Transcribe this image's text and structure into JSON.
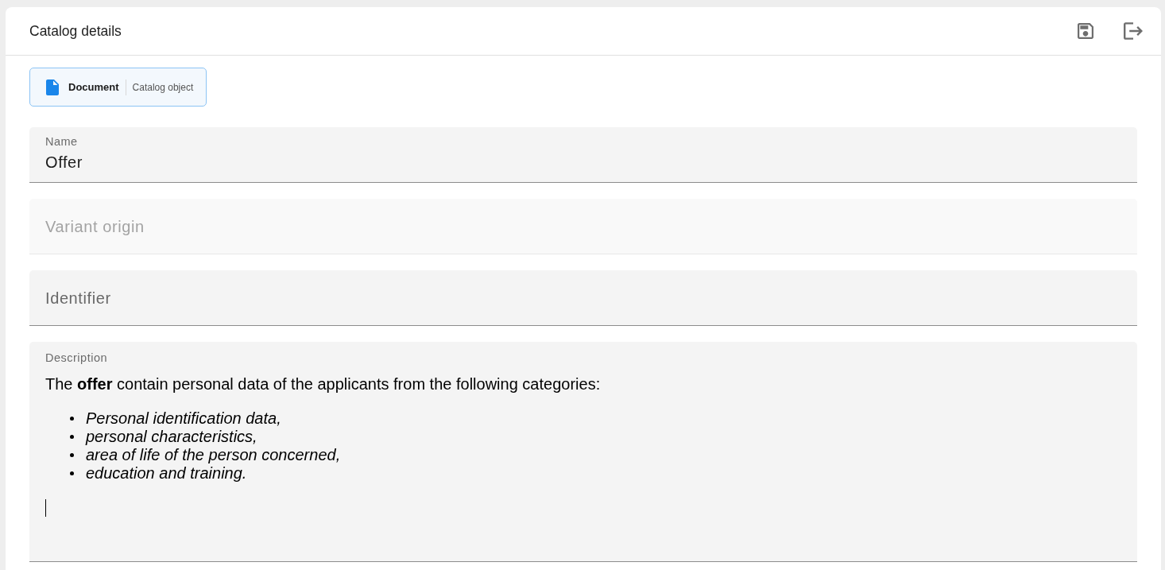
{
  "window": {
    "title": "Catalog details"
  },
  "object_chip": {
    "type": "Document",
    "category": "Catalog object"
  },
  "fields": [
    {
      "kind": "text",
      "label": "Name",
      "value": "Offer",
      "disabled": false
    },
    {
      "kind": "text",
      "label": "Variant origin",
      "disabled": true
    },
    {
      "kind": "text",
      "label": "Identifier",
      "disabled": false
    },
    {
      "kind": "rich",
      "label": "Description",
      "paragraph": "The **offer** contain personal data of the applicants from the following categories:",
      "bullets": [
        "Personal identification data,",
        "personal characteristics,",
        "area of life of the person concerned,",
        "education and training."
      ],
      "focused": true
    }
  ]
}
